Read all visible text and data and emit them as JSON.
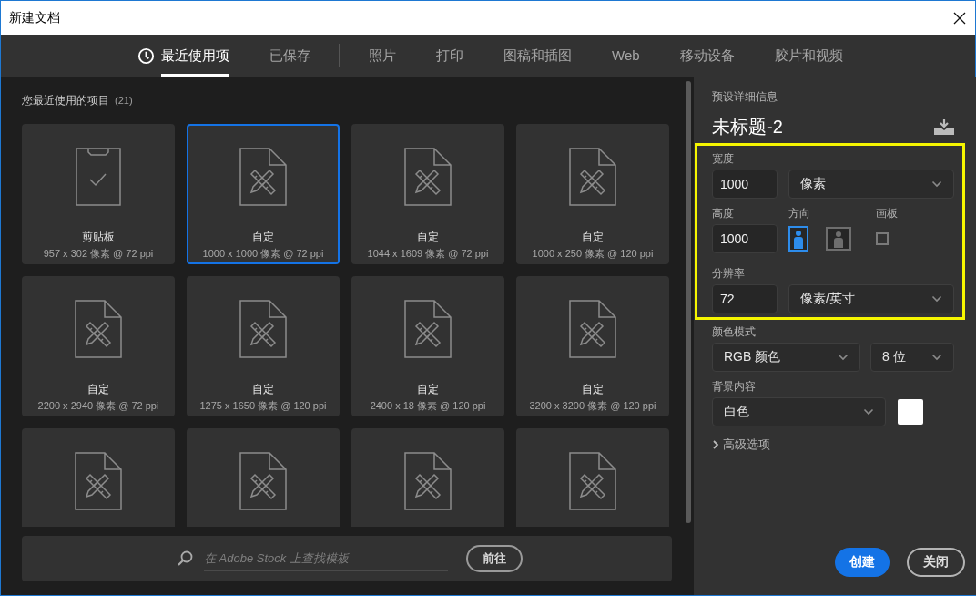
{
  "window": {
    "title": "新建文档"
  },
  "tab_groups": [
    [
      {
        "label": "最近使用项",
        "selected": true,
        "has_icon": true
      },
      {
        "label": "已保存",
        "selected": false,
        "has_icon": false
      }
    ],
    [
      {
        "label": "照片",
        "selected": false,
        "has_icon": false
      },
      {
        "label": "打印",
        "selected": false,
        "has_icon": false
      },
      {
        "label": "图稿和插图",
        "selected": false,
        "has_icon": false
      },
      {
        "label": "Web",
        "selected": false,
        "has_icon": false
      },
      {
        "label": "移动设备",
        "selected": false,
        "has_icon": false
      },
      {
        "label": "胶片和视频",
        "selected": false,
        "has_icon": false
      }
    ]
  ],
  "recent": {
    "heading": "您最近使用的项目",
    "count": "(21)",
    "items": [
      {
        "kind": "clipboard",
        "name": "剪贴板",
        "size": "957 x 302 像素 @ 72 ppi",
        "selected": false
      },
      {
        "kind": "custom",
        "name": "自定",
        "size": "1000 x 1000 像素 @ 72 ppi",
        "selected": true
      },
      {
        "kind": "custom",
        "name": "自定",
        "size": "1044 x 1609 像素 @ 72 ppi",
        "selected": false
      },
      {
        "kind": "custom",
        "name": "自定",
        "size": "1000 x 250 像素 @ 120 ppi",
        "selected": false
      },
      {
        "kind": "custom",
        "name": "自定",
        "size": "2200 x 2940 像素 @ 72 ppi",
        "selected": false
      },
      {
        "kind": "custom",
        "name": "自定",
        "size": "1275 x 1650 像素 @ 120 ppi",
        "selected": false
      },
      {
        "kind": "custom",
        "name": "自定",
        "size": "2400 x 18 像素 @ 120 ppi",
        "selected": false
      },
      {
        "kind": "custom",
        "name": "自定",
        "size": "3200 x 3200 像素 @ 120 ppi",
        "selected": false
      },
      {
        "kind": "custom",
        "selected": false
      },
      {
        "kind": "custom",
        "selected": false
      },
      {
        "kind": "custom",
        "selected": false
      },
      {
        "kind": "custom",
        "selected": false
      }
    ]
  },
  "stock_search": {
    "placeholder": "在 Adobe Stock 上查找模板",
    "button": "前往"
  },
  "details": {
    "heading": "预设详细信息",
    "name": "未标题-2",
    "width": {
      "label": "宽度",
      "value": "1000",
      "unit": "像素"
    },
    "height": {
      "label": "高度",
      "value": "1000"
    },
    "orientation": {
      "label": "方向",
      "options": [
        {
          "kind": "portrait",
          "selected": true
        },
        {
          "kind": "landscape",
          "selected": false
        }
      ]
    },
    "artboard": {
      "label": "画板",
      "checked": false
    },
    "resolution": {
      "label": "分辨率",
      "value": "72",
      "unit": "像素/英寸"
    },
    "color_mode": {
      "label": "颜色模式",
      "mode": "RGB 颜色",
      "depth": "8 位"
    },
    "background": {
      "label": "背景内容",
      "value": "白色"
    },
    "advanced": {
      "label": "高级选项",
      "expanded": false
    }
  },
  "buttons": [
    {
      "label": "创建",
      "kind": "primary"
    },
    {
      "label": "关闭",
      "kind": "secondary"
    }
  ]
}
